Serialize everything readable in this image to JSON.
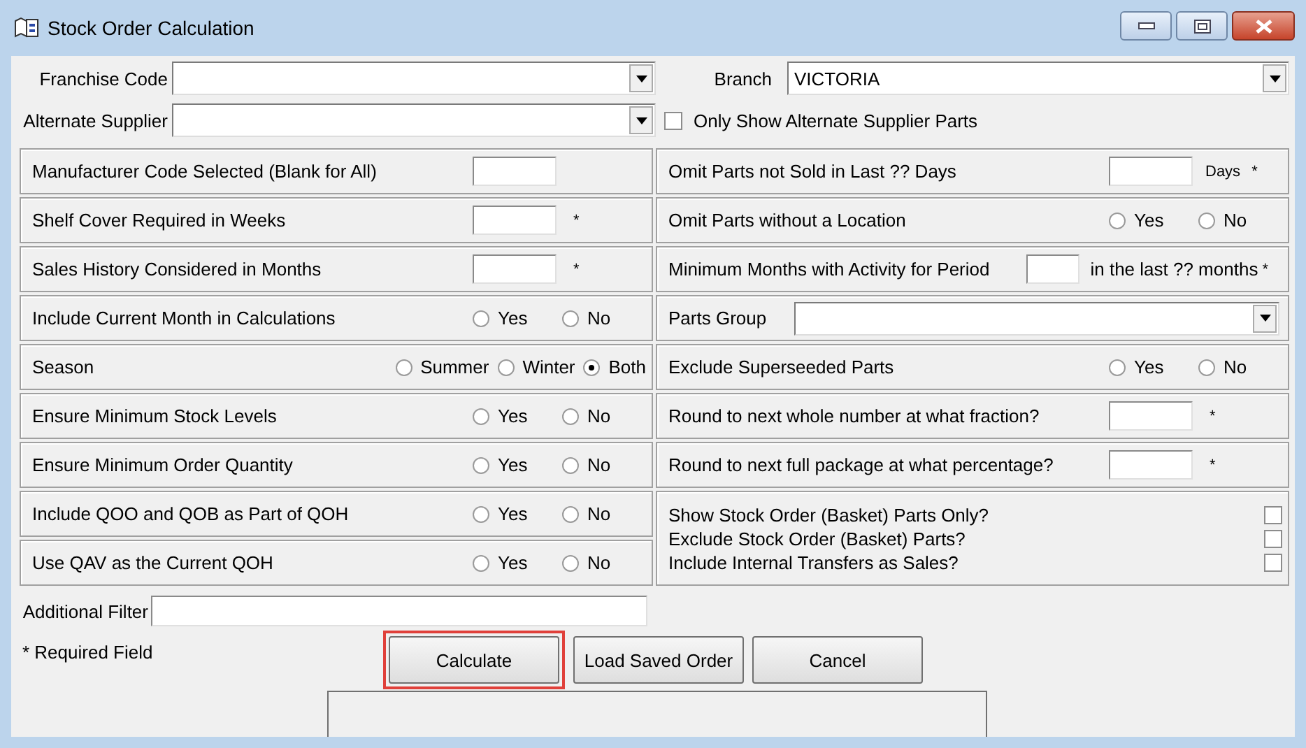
{
  "window": {
    "title": "Stock Order Calculation"
  },
  "franchise_code": {
    "label": "Franchise Code"
  },
  "branch": {
    "label": "Branch",
    "value": "VICTORIA"
  },
  "alternate_supplier": {
    "label": "Alternate Supplier"
  },
  "only_alternate": {
    "label": "Only Show Alternate Supplier Parts",
    "checked": false
  },
  "left_rows": [
    {
      "kind": "text",
      "label": "Manufacturer Code Selected (Blank for All)"
    },
    {
      "kind": "text",
      "label": "Shelf Cover Required in Weeks",
      "mark": "*"
    },
    {
      "kind": "text",
      "label": "Sales History Considered in Months",
      "mark": "*"
    },
    {
      "kind": "radio",
      "label": "Include Current Month in Calculations",
      "options": [
        {
          "label": "Yes",
          "selected": false
        },
        {
          "label": "No",
          "selected": false
        }
      ]
    },
    {
      "kind": "radio",
      "label": "Season",
      "options": [
        {
          "label": "Summer",
          "selected": false
        },
        {
          "label": "Winter",
          "selected": false
        },
        {
          "label": "Both",
          "selected": true
        }
      ]
    },
    {
      "kind": "radio",
      "label": "Ensure Minimum Stock Levels",
      "options": [
        {
          "label": "Yes",
          "selected": false
        },
        {
          "label": "No",
          "selected": false
        }
      ]
    },
    {
      "kind": "radio",
      "label": "Ensure Minimum Order Quantity",
      "options": [
        {
          "label": "Yes",
          "selected": false
        },
        {
          "label": "No",
          "selected": false
        }
      ]
    },
    {
      "kind": "radio",
      "label": "Include QOO and QOB as Part of QOH",
      "options": [
        {
          "label": "Yes",
          "selected": false
        },
        {
          "label": "No",
          "selected": false
        }
      ]
    },
    {
      "kind": "radio",
      "label": "Use QAV as the Current QOH",
      "options": [
        {
          "label": "Yes",
          "selected": false
        },
        {
          "label": "No",
          "selected": false
        }
      ]
    }
  ],
  "right_rows": [
    {
      "kind": "text",
      "label": "Omit Parts not Sold in Last ?? Days",
      "suffix": "Days",
      "mark": "*"
    },
    {
      "kind": "radio",
      "label": "Omit Parts without a Location",
      "options": [
        {
          "label": "Yes",
          "selected": false
        },
        {
          "label": "No",
          "selected": false
        }
      ]
    },
    {
      "kind": "short_text",
      "label": "Minimum Months with Activity for Period",
      "suffix": "in the last ?? months",
      "mark": "*"
    },
    {
      "kind": "dropdown",
      "label": "Parts Group"
    },
    {
      "kind": "radio",
      "label": "Exclude Superseeded Parts",
      "options": [
        {
          "label": "Yes",
          "selected": false
        },
        {
          "label": "No",
          "selected": false
        }
      ]
    },
    {
      "kind": "text",
      "label": "Round to next whole number at what fraction?",
      "mark": "*"
    },
    {
      "kind": "text",
      "label": "Round to next full package at what percentage?",
      "mark": "*"
    },
    {
      "kind": "checks",
      "items": [
        {
          "label": "Show Stock Order (Basket) Parts Only?",
          "checked": false
        },
        {
          "label": "Exclude Stock Order (Basket) Parts?",
          "checked": false
        },
        {
          "label": "Include Internal Transfers as Sales?",
          "checked": false
        }
      ]
    }
  ],
  "additional_filter": {
    "label": "Additional Filter"
  },
  "required_note": "* Required Field",
  "buttons": [
    {
      "label": "Calculate",
      "highlighted": true
    },
    {
      "label": "Load Saved Order",
      "highlighted": false
    },
    {
      "label": "Cancel",
      "highlighted": false
    }
  ]
}
